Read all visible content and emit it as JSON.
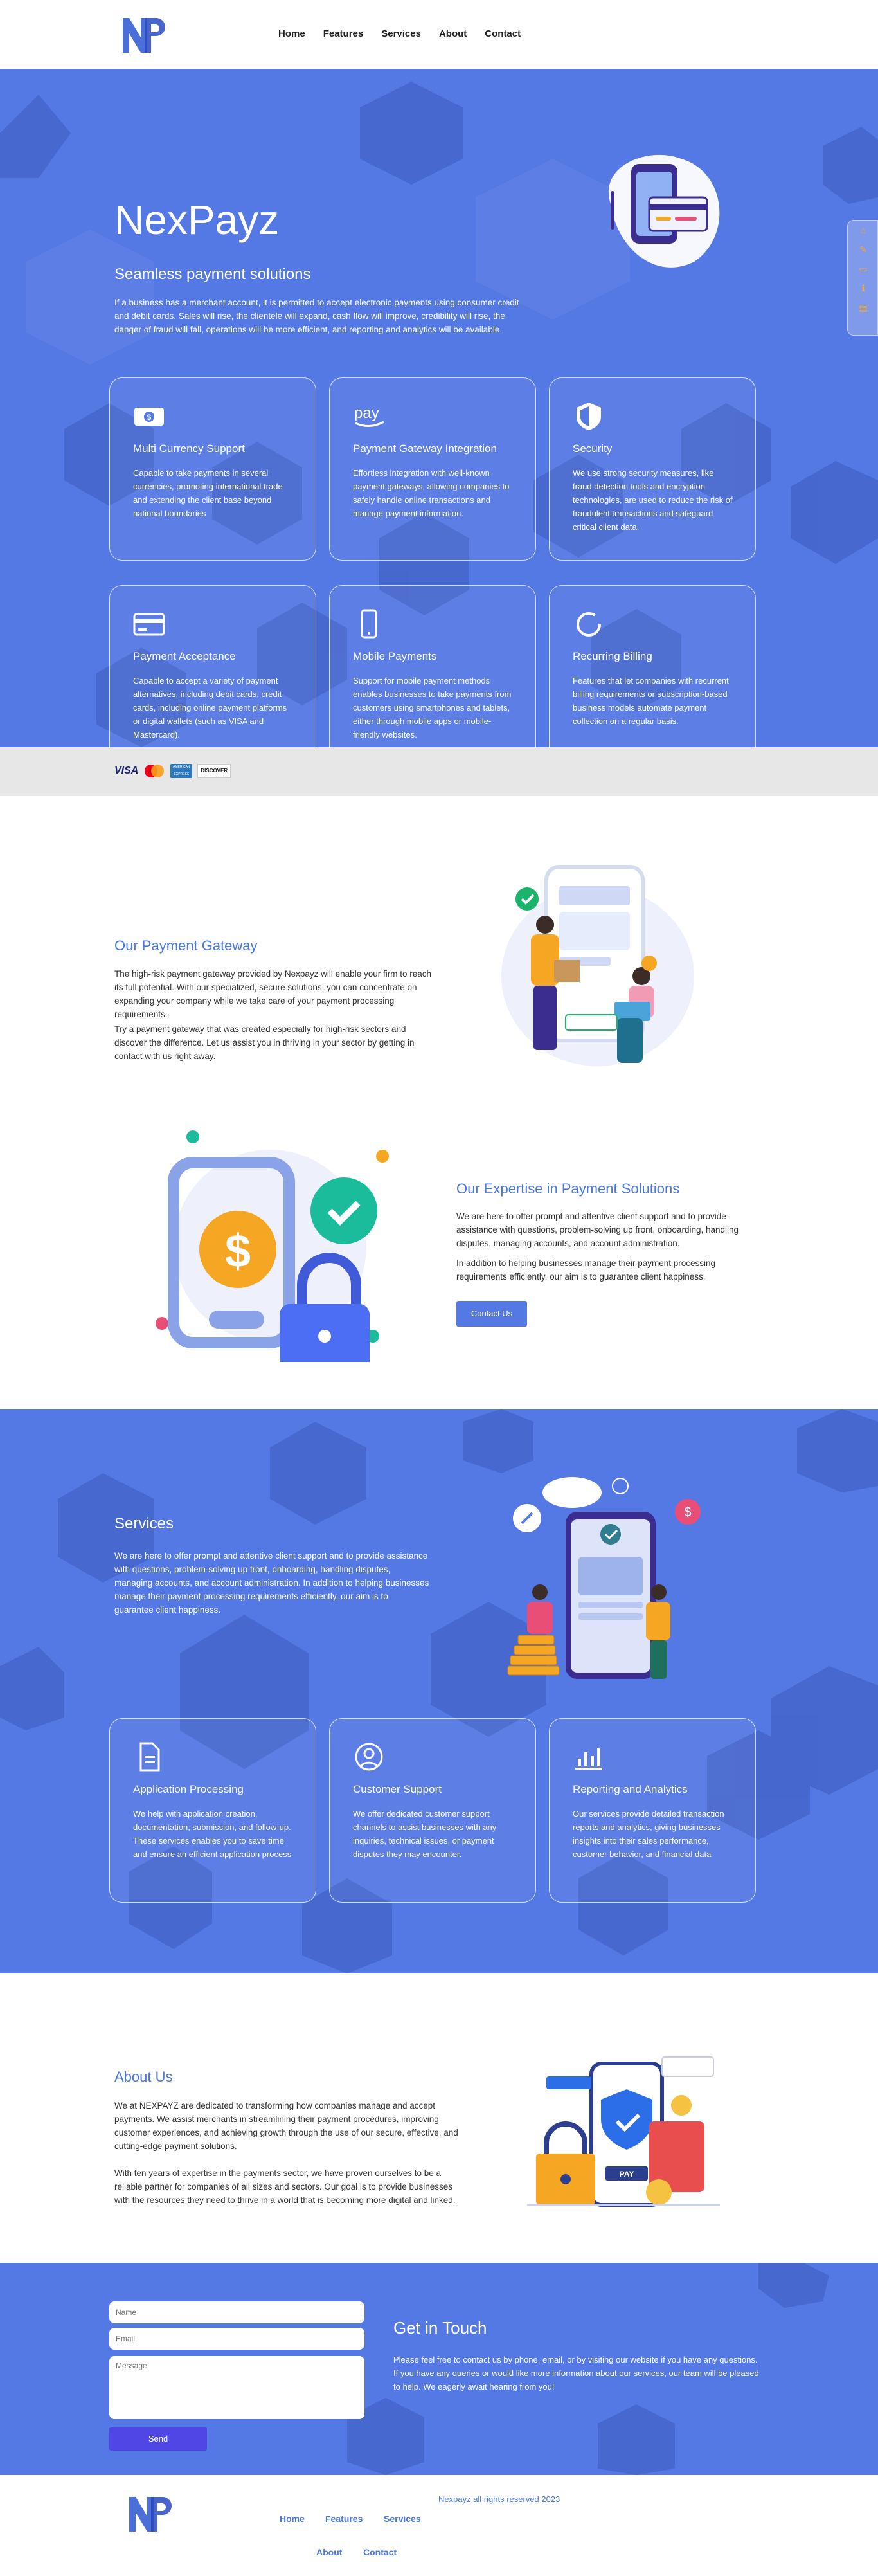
{
  "header": {
    "logo_text": "NP",
    "nav": [
      "Home",
      "Features",
      "Services",
      "About",
      "Contact"
    ]
  },
  "hero": {
    "title": "NexPayz",
    "subtitle": "Seamless payment solutions",
    "intro": "If a business has a merchant account, it is permitted to accept electronic payments using consumer credit and debit cards. Sales will rise, the clientele will expand, cash flow will improve, credibility will rise, the danger of fraud will fall, operations will be more efficient, and reporting and analytics will be available.",
    "features": [
      {
        "icon": "money-icon",
        "title": "Multi Currency Support",
        "text": "Capable to take payments in several currencies, promoting international trade and extending the client base beyond national boundaries"
      },
      {
        "icon": "amazon-pay-icon",
        "icon_text": "pay",
        "title": "Payment Gateway Integration",
        "text": "Effortless integration with well-known payment gateways, allowing companies to safely handle online transactions and manage payment information."
      },
      {
        "icon": "shield-icon",
        "title": "Security",
        "text": "We use strong security measures, like fraud detection tools and encryption technologies, are used to reduce the risk of fraudulent transactions and safeguard critical client data."
      },
      {
        "icon": "credit-card-icon",
        "title": "Payment Acceptance",
        "text": "Capable to accept a variety of payment alternatives, including debit cards, credit cards, including online payment platforms or digital wallets (such as VISA and Mastercard)."
      },
      {
        "icon": "mobile-icon",
        "title": "Mobile Payments",
        "text": "Support for mobile payment methods enables businesses to take payments from customers using smartphones and tablets, either through mobile apps or mobile-friendly websites."
      },
      {
        "icon": "circle-icon",
        "title": "Recurring Billing",
        "text": "Features that let companies with recurrent billing requirements or subscription-based business models automate payment collection on a regular basis."
      }
    ]
  },
  "payment_logos": [
    "VISA",
    "mastercard",
    "AMERICAN EXPRESS",
    "DISCOVER"
  ],
  "gateway": {
    "title": "Our Payment Gateway",
    "p1": "The high-risk payment gateway provided by Nexpayz will enable your firm to reach its full potential. With our specialized, secure solutions, you can concentrate on expanding your company while we take care of your payment processing requirements.",
    "p2": "Try a payment gateway that was created especially for high-risk sectors and discover the difference. Let us assist you in thriving in your sector by getting in contact with us right away."
  },
  "expertise": {
    "title": "Our Expertise in Payment Solutions",
    "p1": "We are here to offer prompt and attentive client support and to provide assistance with questions, problem-solving up front, onboarding, handling disputes, managing accounts, and account administration.",
    "p2": "In addition to helping businesses manage their payment processing requirements efficiently, our aim is to guarantee client happiness.",
    "button": "Contact Us"
  },
  "services": {
    "title": "Services",
    "text": "We are here to offer prompt and attentive client support and to provide assistance with questions, problem-solving up front, onboarding, handling disputes, managing accounts, and account administration. In addition to helping businesses manage their payment processing requirements efficiently, our aim is to guarantee client happiness.",
    "cards": [
      {
        "icon": "document-icon",
        "title": "Application Processing",
        "text": "We help with application creation, documentation, submission, and follow-up. These services enables you to save time and ensure an efficient application process"
      },
      {
        "icon": "user-icon",
        "title": "Customer Support",
        "text": "We offer dedicated customer support channels to assist businesses with any inquiries, technical issues, or payment disputes they may encounter."
      },
      {
        "icon": "bar-chart-icon",
        "title": "Reporting and Analytics",
        "text": "Our services provide detailed transaction reports and analytics, giving businesses insights into their sales performance, customer behavior, and financial data"
      }
    ]
  },
  "about": {
    "title": "About Us",
    "p1": "We at NEXPAYZ are dedicated to transforming how companies manage and accept payments. We assist merchants in streamlining their payment procedures, improving customer experiences, and achieving growth through the use of our secure, effective, and cutting-edge payment solutions.",
    "p2": "With ten years of expertise in the payments sector, we have proven ourselves to be a reliable partner for companies of all sizes and sectors. Our goal is to provide businesses with the resources they need to thrive in a world that is becoming more digital and linked."
  },
  "contact": {
    "name_placeholder": "Name",
    "email_placeholder": "Email",
    "message_placeholder": "Message",
    "send": "Send",
    "title": "Get in Touch",
    "text": "Please feel free to contact us by phone, email, or by visiting our website if you have any questions. If you have any queries or would like more information about our services, our team will be pleased to help. We eagerly await hearing from you!"
  },
  "footer": {
    "copyright": "Nexpayz all rights reserved 2023",
    "nav": [
      "Home",
      "Features",
      "Services",
      "About",
      "Contact"
    ]
  },
  "colors": {
    "primary": "#5478e4",
    "hex_dark": "#2d4aa8",
    "accent": "#4a78e0",
    "button": "#4f46e5"
  }
}
